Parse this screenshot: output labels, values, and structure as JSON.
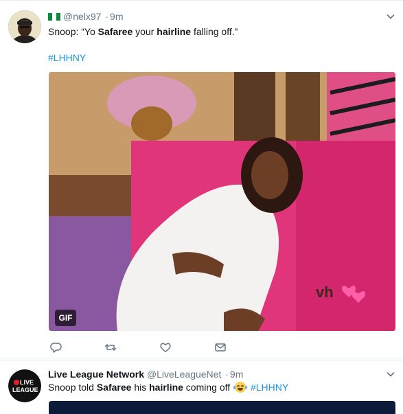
{
  "tweets": [
    {
      "display_name": "",
      "handle": "@nelx97",
      "separator": "·",
      "time": "9m",
      "text_parts": [
        "Snoop: “Yo ",
        "Safaree",
        " your ",
        "hairline",
        " falling  off.”"
      ],
      "hashtag": "#LHHNY",
      "media": {
        "type": "gif",
        "badge": "GIF",
        "watermark": "vh1"
      },
      "actions": [
        "reply-icon",
        "retweet-icon",
        "like-icon",
        "direct-message-icon"
      ]
    },
    {
      "display_name": "Live League Network",
      "handle": "@LiveLeagueNet",
      "separator": "·",
      "time": "9m",
      "text_parts": [
        "Snoop told ",
        "Safaree",
        " his ",
        "hairline",
        " coming off "
      ],
      "emoji": "face-with-tears-of-joy",
      "hashtag": "#LHHNY",
      "avatar_text": [
        "LIVE",
        "LEAGUE"
      ]
    }
  ],
  "colors": {
    "link": "#1b95e0",
    "muted": "#657786",
    "text": "#14171a",
    "divider": "#e6ecf0",
    "flag_green": "#0a8a3a"
  }
}
